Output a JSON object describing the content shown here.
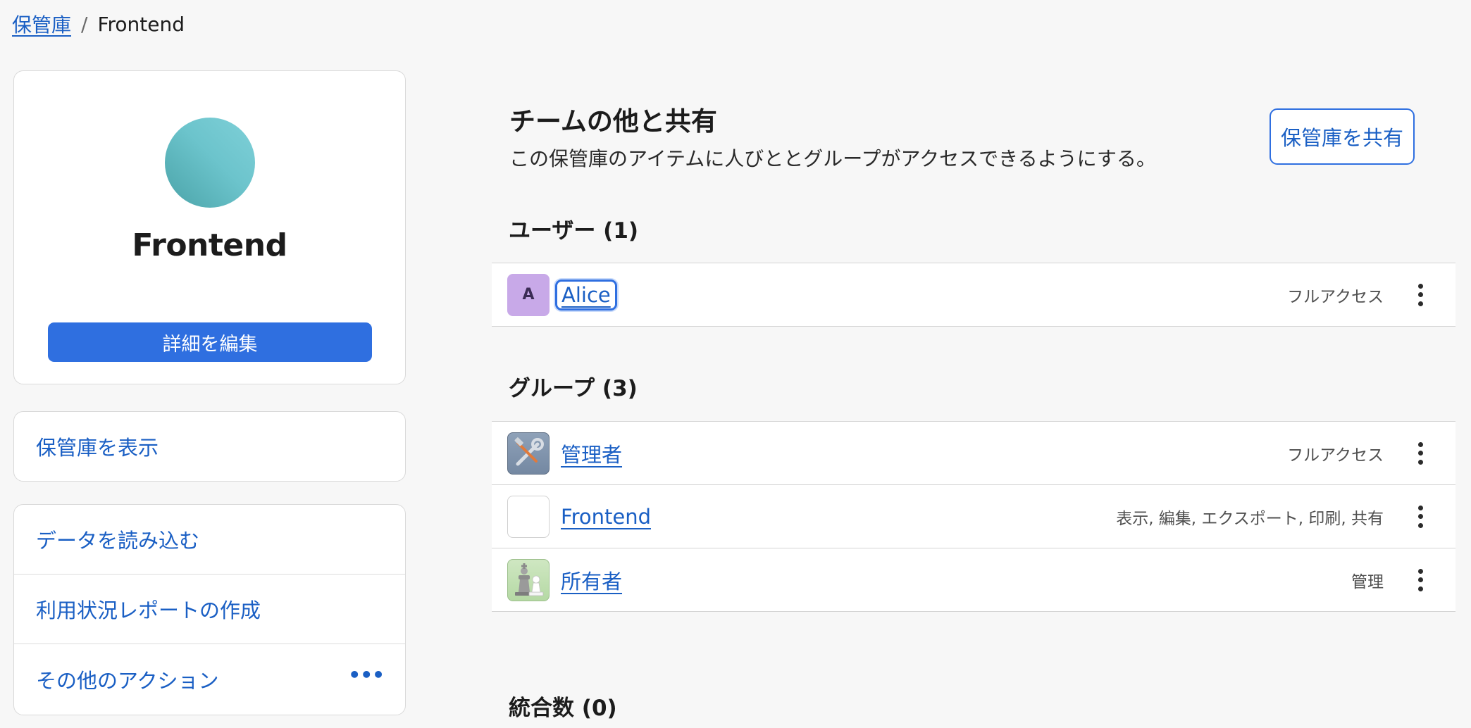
{
  "breadcrumb": {
    "root": "保管庫",
    "separator": "/",
    "current": "Frontend"
  },
  "vault": {
    "name": "Frontend",
    "avatar_color": "#5fb8be",
    "edit_label": "詳細を編集"
  },
  "sidebar": {
    "view_label": "保管庫を表示",
    "actions": [
      {
        "label": "データを読み込む"
      },
      {
        "label": "利用状況レポートの作成"
      },
      {
        "label": "その他のアクション",
        "icon": "more-horizontal-icon"
      }
    ]
  },
  "share": {
    "title": "チームの他と共有",
    "subtitle": "この保管庫のアイテムに人びととグループがアクセスできるようにする。",
    "button_label": "保管庫を共有"
  },
  "users": {
    "heading": "ユーザー (1)",
    "items": [
      {
        "initial": "A",
        "name": "Alice",
        "permission": "フルアクセス",
        "avatar_color": "#c8a9e8"
      }
    ]
  },
  "groups": {
    "heading": "グループ (3)",
    "items": [
      {
        "name": "管理者",
        "permission": "フルアクセス",
        "icon": "tools-icon"
      },
      {
        "name": "Frontend",
        "permission": "表示, 編集, エクスポート, 印刷, 共有",
        "icon": "color-grid-icon"
      },
      {
        "name": "所有者",
        "permission": "管理",
        "icon": "chess-pieces-icon"
      }
    ]
  },
  "integrations": {
    "heading": "統合数 (0)"
  },
  "colors": {
    "accent": "#2f6fe0",
    "link": "#1a5fc4",
    "background": "#f7f7f7"
  }
}
